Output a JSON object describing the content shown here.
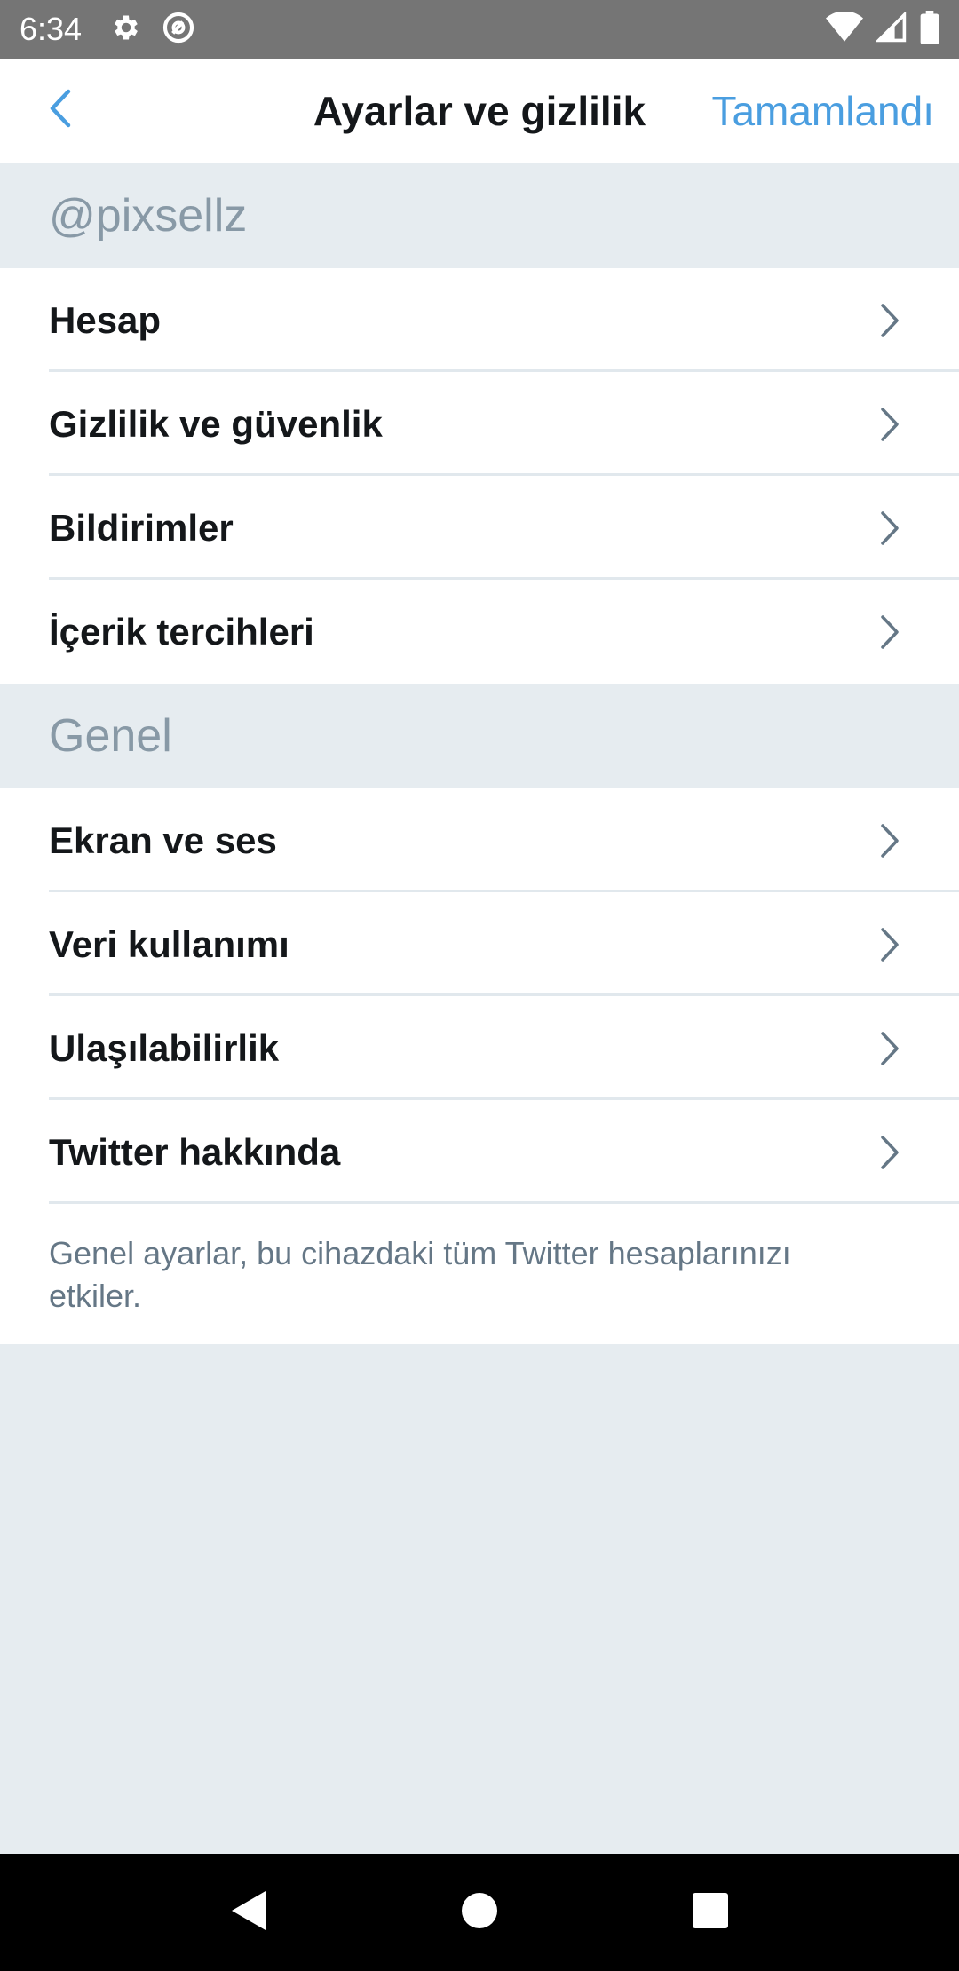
{
  "status_bar": {
    "time": "6:34",
    "icons": [
      "gear-icon",
      "at-sync-icon",
      "wifi-icon",
      "signal-icon",
      "battery-icon"
    ]
  },
  "header": {
    "back_icon": "chevron-left-icon",
    "title": "Ayarlar ve gizlilik",
    "done_label": "Tamamlandı",
    "accent_color": "#4a9ee0"
  },
  "sections": [
    {
      "header": "@pixsellz",
      "items": [
        {
          "label": "Hesap"
        },
        {
          "label": "Gizlilik ve güvenlik"
        },
        {
          "label": "Bildirimler"
        },
        {
          "label": "İçerik tercihleri"
        }
      ]
    },
    {
      "header": "Genel",
      "items": [
        {
          "label": "Ekran ve ses"
        },
        {
          "label": "Veri kullanımı"
        },
        {
          "label": "Ulaşılabilirlik"
        },
        {
          "label": "Twitter hakkında"
        }
      ],
      "footer_note": "Genel ayarlar, bu cihazdaki tüm Twitter hesaplarınızı etkiler."
    }
  ],
  "nav_bar": {
    "icons": [
      "back-triangle-icon",
      "home-circle-icon",
      "recents-square-icon"
    ]
  }
}
